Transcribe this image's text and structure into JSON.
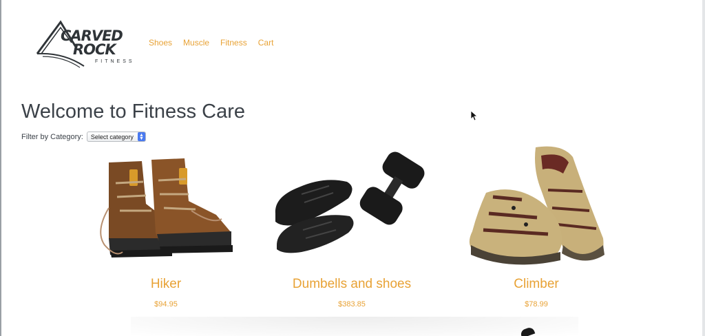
{
  "brand": {
    "logo_line1": "CARVED",
    "logo_line2": "ROCK",
    "logo_line3": "FITNESS"
  },
  "nav": {
    "items": [
      {
        "label": "Shoes"
      },
      {
        "label": "Muscle"
      },
      {
        "label": "Fitness"
      },
      {
        "label": "Cart"
      }
    ]
  },
  "page": {
    "title": "Welcome to Fitness Care"
  },
  "filter": {
    "label": "Filter by Category:",
    "selected": "Select category"
  },
  "products": [
    {
      "name": "Hiker",
      "price": "$94.95",
      "image_icon": "hiking-boots-image"
    },
    {
      "name": "Dumbells and shoes",
      "price": "$383.85",
      "image_icon": "dumbbell-shoes-image"
    },
    {
      "name": "Climber",
      "price": "$78.99",
      "image_icon": "sandals-image"
    }
  ],
  "colors": {
    "accent": "#e8a235",
    "text": "#3b4148",
    "select_arrow": "#4a7af0"
  }
}
